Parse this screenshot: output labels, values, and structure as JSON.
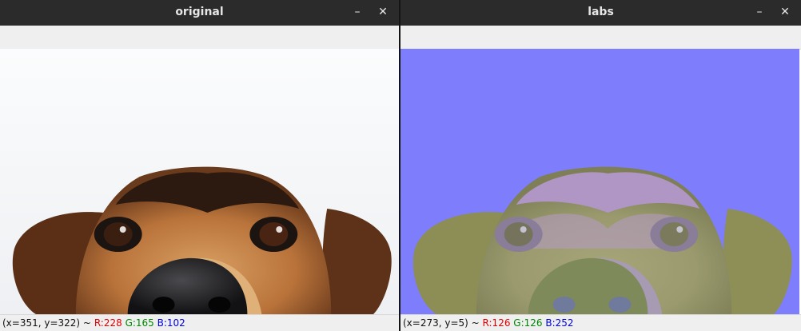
{
  "windows": [
    {
      "title": "original",
      "status": {
        "coords": "(x=351, y=322) ~",
        "r": "R:228",
        "g": "G:165",
        "b": "B:102"
      }
    },
    {
      "title": "labs",
      "status": {
        "coords": "(x=273, y=5) ~",
        "r": "R:126",
        "g": "G:126",
        "b": "B:252"
      }
    }
  ],
  "controls": {
    "minimize": "–",
    "close": "✕"
  },
  "colors": {
    "titlebar": "#2b2b2b",
    "toolbar": "#efefef",
    "labs_background": "#7e7efc",
    "original_background": "#f7f8fa"
  }
}
